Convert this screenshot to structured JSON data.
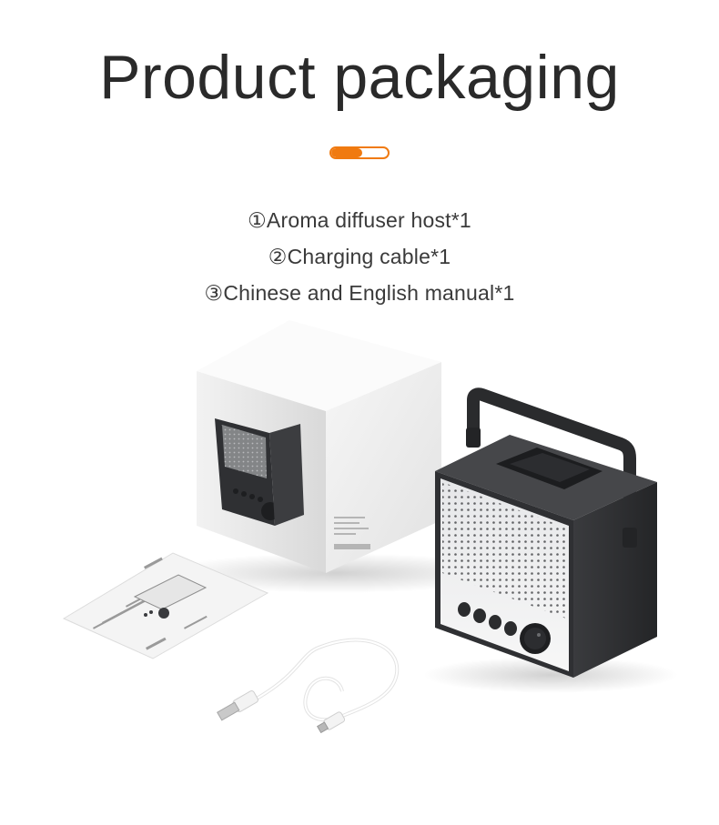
{
  "title": "Product packaging",
  "divider": {
    "accent_color": "#f07a10",
    "fill_fraction": 0.55
  },
  "contents": [
    {
      "text": "①Aroma diffuser host*1"
    },
    {
      "text": "②Charging cable*1"
    },
    {
      "text": "③Chinese and English manual*1"
    }
  ],
  "colors": {
    "title": "#2a2a2a",
    "text": "#3a3a3a",
    "device_body": "#2f3033",
    "box": "#e9e9e9"
  }
}
